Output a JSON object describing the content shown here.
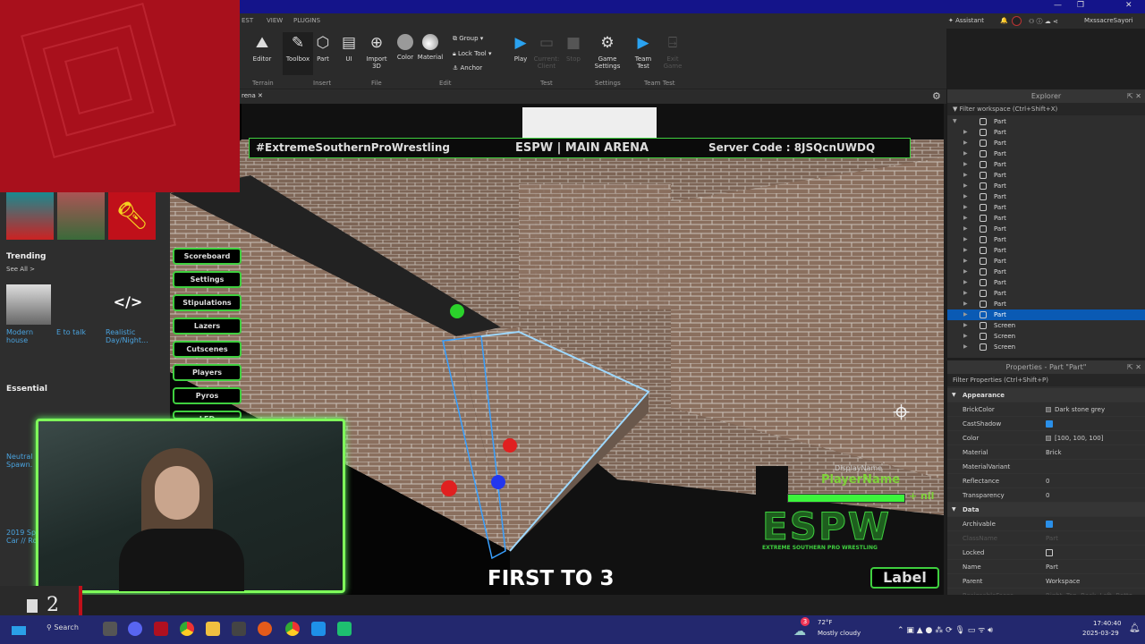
{
  "window": {
    "minimize": "—",
    "maximize": "❐",
    "close": "✕"
  },
  "menubar": {
    "tabs": [
      "EST",
      "VIEW",
      "PLUGINS"
    ],
    "assistant": "Assistant",
    "username": "MxssacreSayori"
  },
  "ribbon": {
    "buttons": [
      {
        "label": "Editor",
        "icon": "terrain-editor-icon"
      },
      {
        "label": "Toolbox",
        "icon": "toolbox-icon"
      },
      {
        "label": "Part",
        "icon": "part-cube-icon"
      },
      {
        "label": "UI",
        "icon": "ui-icon"
      },
      {
        "label": "Import\n3D",
        "icon": "import-3d-icon"
      },
      {
        "label": "Color",
        "icon": "color-icon"
      },
      {
        "label": "Material",
        "icon": "material-icon"
      },
      {
        "label": "Play",
        "icon": "play-icon"
      },
      {
        "label": "Current:\nClient",
        "icon": "client-icon"
      },
      {
        "label": "Stop",
        "icon": "stop-icon"
      },
      {
        "label": "Game\nSettings",
        "icon": "gear-icon"
      },
      {
        "label": "Team\nTest",
        "icon": "team-test-icon"
      },
      {
        "label": "Exit\nGame",
        "icon": "exit-game-icon"
      }
    ],
    "edit_small": [
      "Group",
      "Lock Tool",
      "Anchor"
    ],
    "groups": [
      "Terrain",
      "Insert",
      "File",
      "Edit",
      "Test",
      "Settings",
      "Team Test"
    ]
  },
  "doc_tab": "rena",
  "toolbox": {
    "trending_title": "Trending",
    "see_all": "See All >",
    "trending": [
      "Modern house",
      "E to talk",
      "Realistic Day/Night..."
    ],
    "essential_title": "Essential",
    "essential": [
      "Neutral Spawn.",
      "2019 Sp Car // Ro"
    ]
  },
  "game": {
    "header_left": "#ExtremeSouthernProWrestling",
    "header_center": "ESPW | MAIN ARENA",
    "header_right": "Server Code : 8JSQcnUWDQ",
    "menu_buttons": [
      "Scoreboard",
      "Settings",
      "Stipulations",
      "Lazers",
      "Cutscenes",
      "Players",
      "Pyros",
      "LED"
    ],
    "display_name": "DisplayName",
    "player_name": "PlayerName",
    "health_suffix": "+ nil",
    "health": 1.0,
    "logo": "ESPW",
    "logo_sub": "EXTREME SOUTHERN PRO WRESTLING",
    "first_to": "FIRST TO 3",
    "label_button": "Label"
  },
  "counter": "2",
  "explorer": {
    "title": "Explorer",
    "filter": "Filter workspace (Ctrl+Shift+X)",
    "items": [
      "Part",
      "Part",
      "Part",
      "Part",
      "Part",
      "Part",
      "Part",
      "Part",
      "Part",
      "Part",
      "Part",
      "Part",
      "Part",
      "Part",
      "Part",
      "Part",
      "Part",
      "Part",
      "Part",
      "Screen",
      "Screen",
      "Screen"
    ],
    "selected_index": 18
  },
  "properties": {
    "title": "Properties - Part \"Part\"",
    "filter": "Filter Properties (Ctrl+Shift+P)",
    "rows": [
      {
        "cat": "Appearance"
      },
      {
        "k": "BrickColor",
        "v": "Dark stone grey",
        "sw": true
      },
      {
        "k": "CastShadow",
        "chk": true
      },
      {
        "k": "Color",
        "v": "[100, 100, 100]",
        "sw": true
      },
      {
        "k": "Material",
        "v": "Brick"
      },
      {
        "k": "MaterialVariant",
        "v": ""
      },
      {
        "k": "Reflectance",
        "v": "0"
      },
      {
        "k": "Transparency",
        "v": "0"
      },
      {
        "cat": "Data"
      },
      {
        "k": "Archivable",
        "chk": true
      },
      {
        "k": "ClassName",
        "v": "Part",
        "dim": true
      },
      {
        "k": "Locked",
        "chk": false
      },
      {
        "k": "Name",
        "v": "Part"
      },
      {
        "k": "Parent",
        "v": "Workspace"
      },
      {
        "k": "ResizeableFaces",
        "v": "Right, Top, Back, Left, Botto...",
        "dim": true
      }
    ]
  },
  "taskbar": {
    "weather_badge": "3",
    "temp": "72°F",
    "weather": "Mostly cloudy",
    "time": "17:40:40",
    "date": "2025-03-29",
    "search": "Search"
  },
  "colors": {
    "accent_green": "#3fcf3f",
    "selection": "#0a5ab4",
    "title": "#14148a"
  }
}
